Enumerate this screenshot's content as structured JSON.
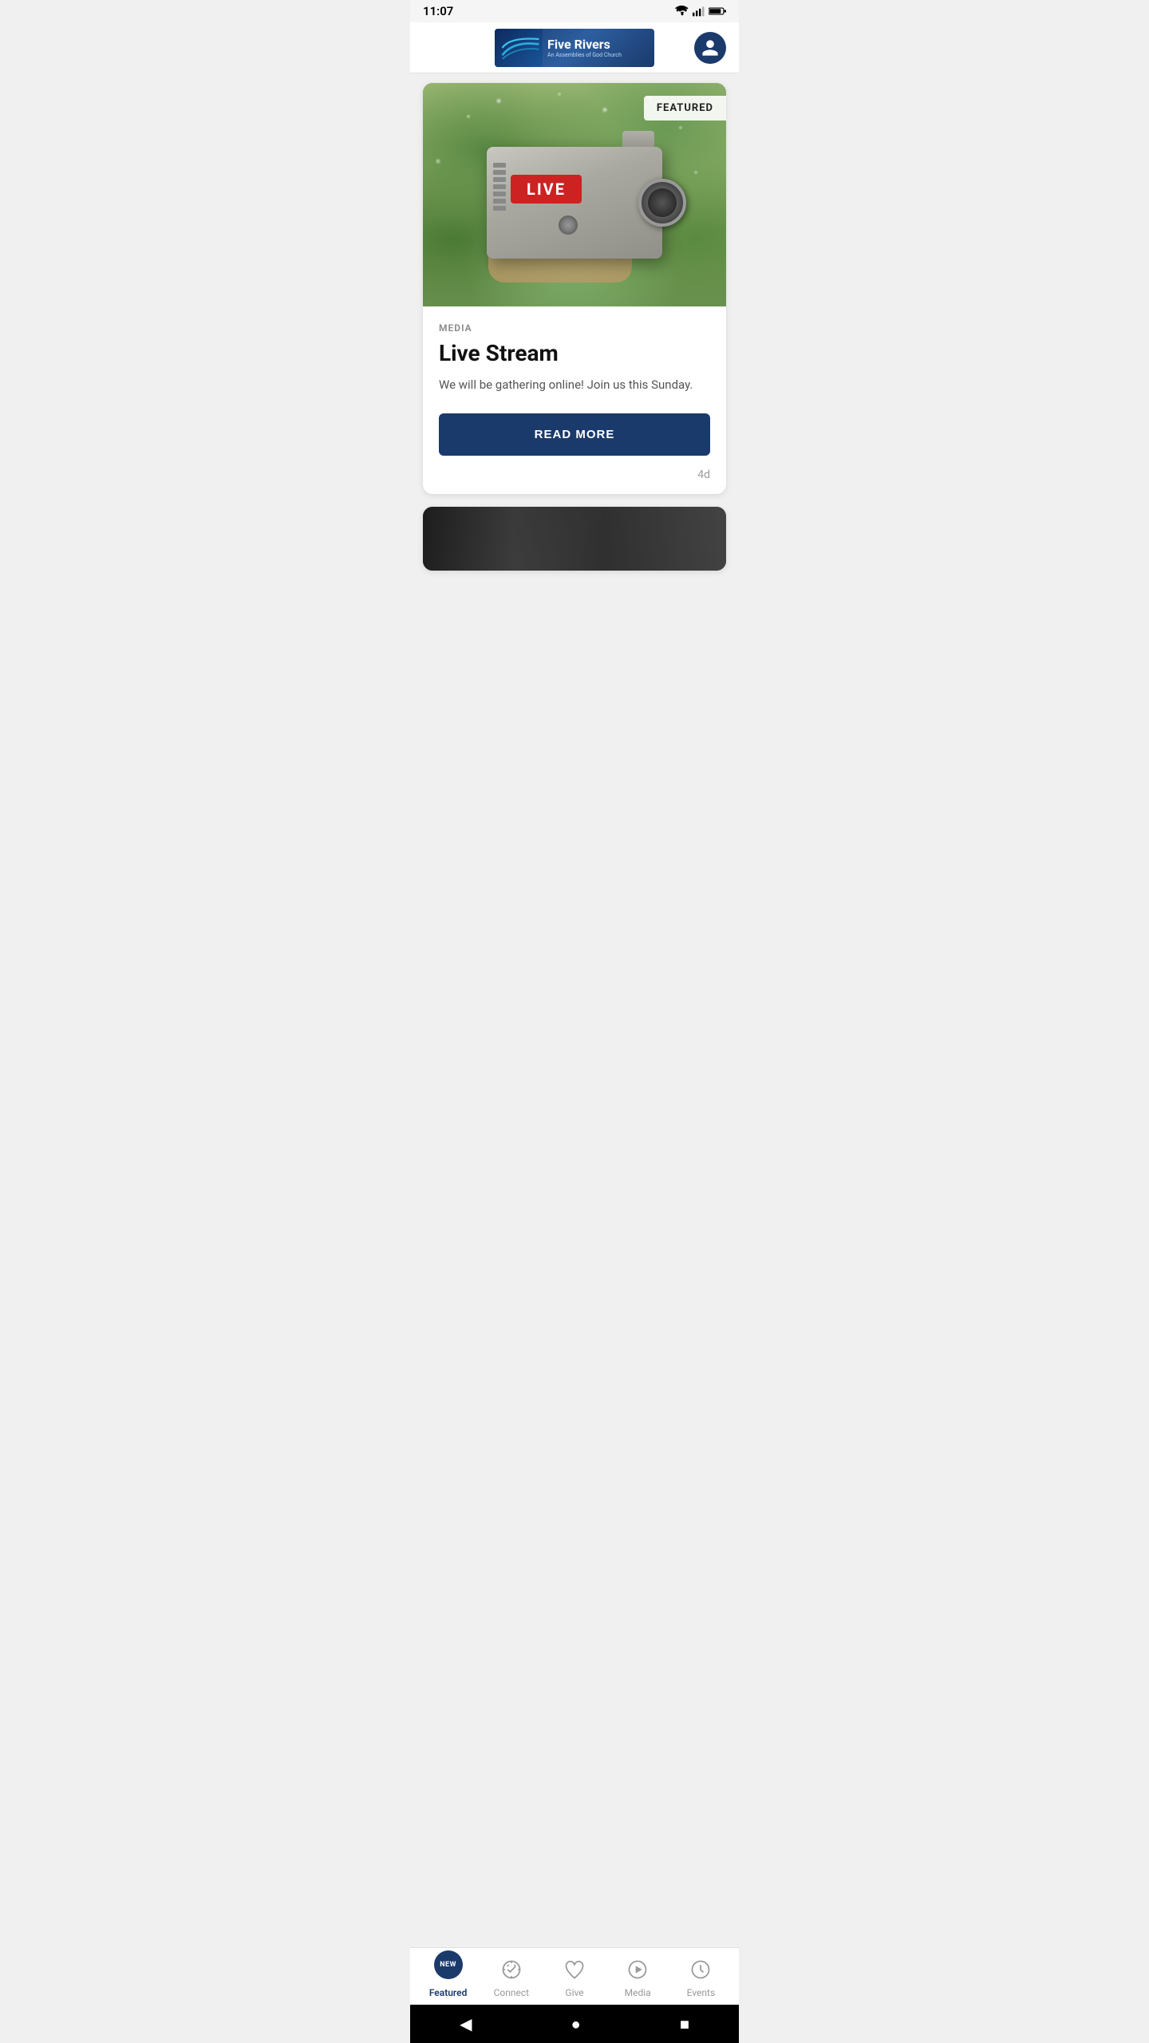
{
  "statusBar": {
    "time": "11:07"
  },
  "header": {
    "logoTextLine1": "Five Rivers",
    "logoTextLine2": "An Assemblies of God Church",
    "avatarAlt": "User profile"
  },
  "featuredCard": {
    "featuredBadge": "FEATURED",
    "liveBadge": "LIVE",
    "category": "MEDIA",
    "title": "Live Stream",
    "description": "We will be gathering online! Join us this Sunday.",
    "readMoreLabel": "READ MORE",
    "timestamp": "4d"
  },
  "bottomNav": {
    "newBadge": "NEW",
    "items": [
      {
        "id": "featured",
        "label": "Featured",
        "icon": "home",
        "active": true
      },
      {
        "id": "connect",
        "label": "Connect",
        "icon": "connect"
      },
      {
        "id": "give",
        "label": "Give",
        "icon": "heart"
      },
      {
        "id": "media",
        "label": "Media",
        "icon": "play"
      },
      {
        "id": "events",
        "label": "Events",
        "icon": "clock"
      }
    ]
  },
  "systemNav": {
    "back": "◀",
    "home": "●",
    "recent": "■"
  }
}
